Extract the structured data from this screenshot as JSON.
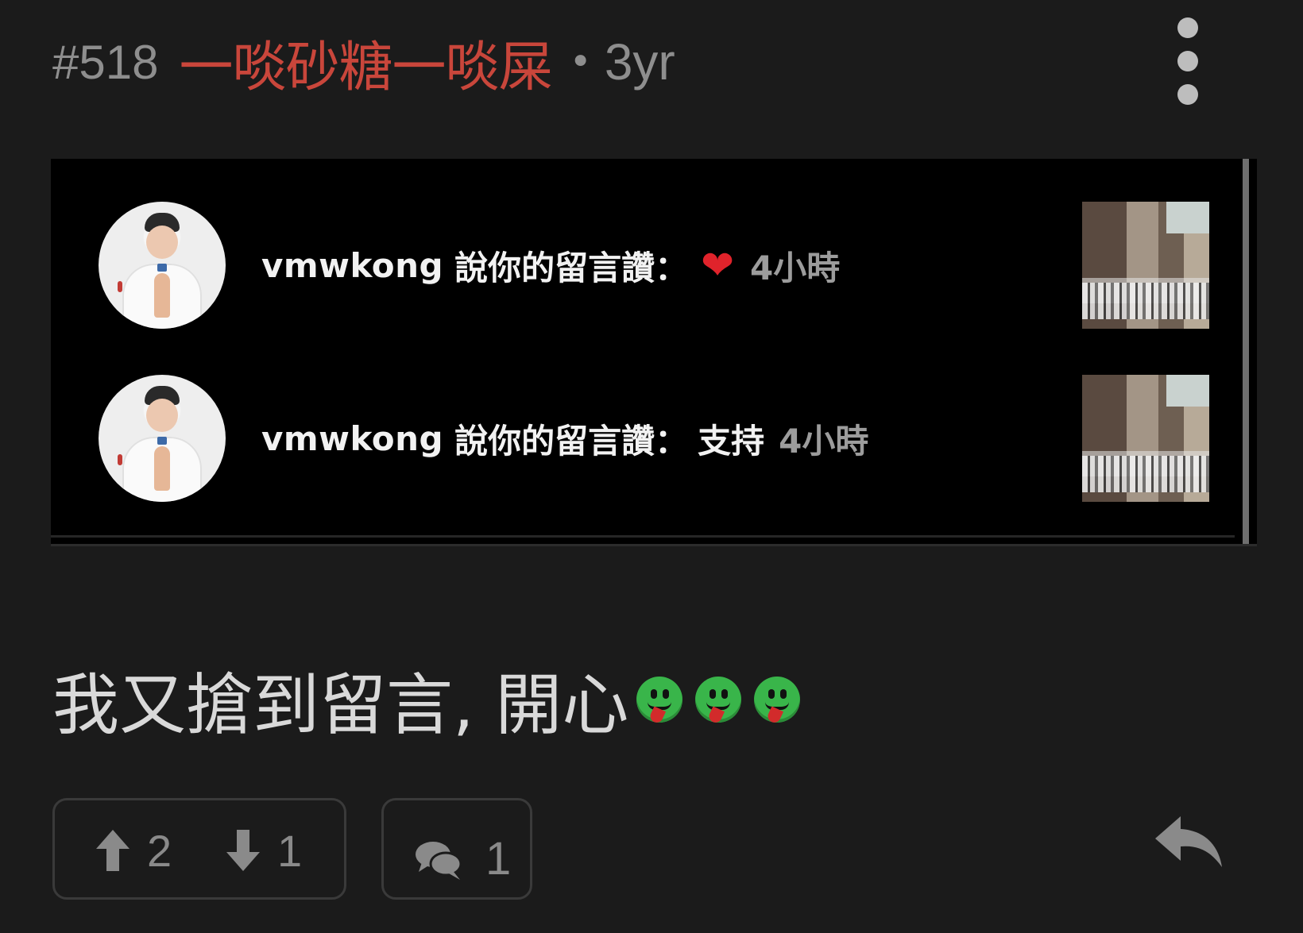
{
  "header": {
    "floor": "#518",
    "username": "一啖砂糖一啖屎",
    "separator": "•",
    "age": "3yr",
    "more_icon": "more-vertical-icon"
  },
  "embed": {
    "notifications": [
      {
        "user": "vmwkong",
        "action": "說你的留言讚：",
        "content_icon": "red-heart-emoji",
        "content": "",
        "time": "4小時"
      },
      {
        "user": "vmwkong",
        "action": "說你的留言讚：",
        "content": "支持",
        "time": "4小時"
      }
    ]
  },
  "message": {
    "text": "我又搶到留言, 開心",
    "emoji": [
      "tongue-out-green-face-emoji",
      "tongue-out-green-face-emoji",
      "tongue-out-green-face-emoji"
    ]
  },
  "actions": {
    "upvotes": "2",
    "downvotes": "1",
    "comments": "1",
    "colors": {
      "icon": "#8a8a8a",
      "border": "#3a3a3a",
      "username": "#c9463b"
    }
  }
}
